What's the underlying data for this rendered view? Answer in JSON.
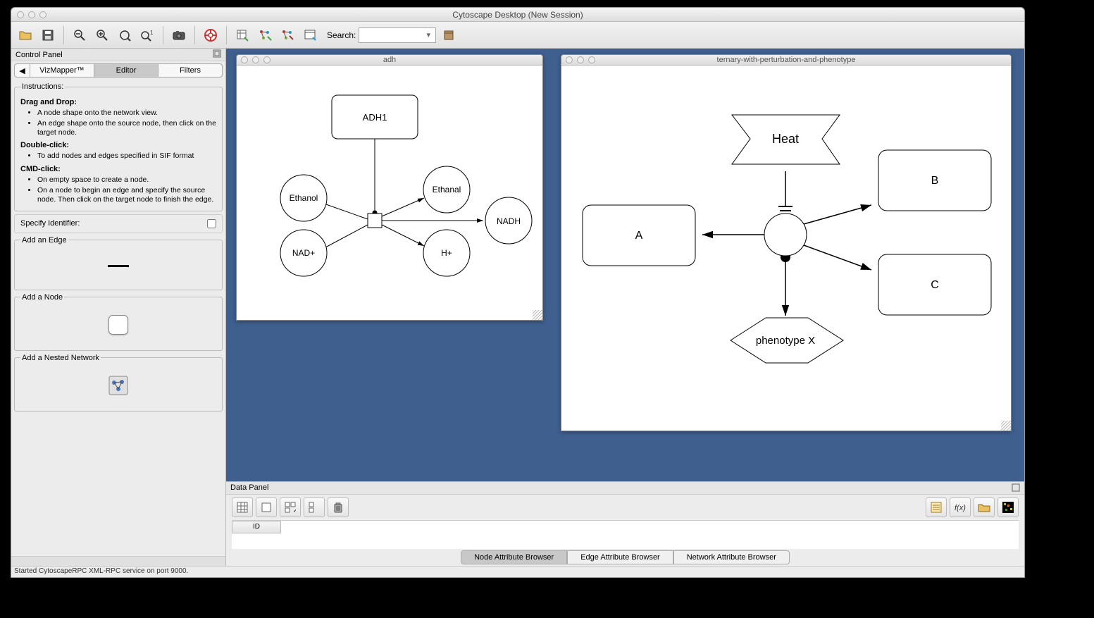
{
  "window": {
    "title": "Cytoscape Desktop (New Session)"
  },
  "toolbar": {
    "search_label": "Search:"
  },
  "control_panel": {
    "header": "Control Panel",
    "tabs": {
      "vizmapper": "VizMapper™",
      "editor": "Editor",
      "filters": "Filters"
    },
    "instructions": {
      "legend": "Instructions:",
      "drag_label": "Drag and Drop:",
      "drag_items": [
        "A node shape onto the network view.",
        "An edge shape onto the source node, then click on the target node."
      ],
      "dbl_label": "Double-click:",
      "dbl_items": [
        "To add nodes and edges specified in SIF format"
      ],
      "cmd_label": "CMD-click:",
      "cmd_items": [
        "On empty space to create a node.",
        "On a node to begin an edge and specify the source node. Then click on the target node to finish the edge."
      ]
    },
    "specify_identifier": "Specify Identifier:",
    "add_edge": "Add an Edge",
    "add_node": "Add a Node",
    "add_nested": "Add a Nested Network"
  },
  "networks": {
    "adh": {
      "title": "adh",
      "nodes": {
        "adh1": "ADH1",
        "ethanol": "Ethanol",
        "nad": "NAD+",
        "ethanal": "Ethanal",
        "h": "H+",
        "nadh": "NADH"
      }
    },
    "ternary": {
      "title": "ternary-with-perturbation-and-phenotype",
      "nodes": {
        "heat": "Heat",
        "a": "A",
        "b": "B",
        "c": "C",
        "phenotype": "phenotype X"
      }
    }
  },
  "data_panel": {
    "header": "Data Panel",
    "col_id": "ID",
    "tabs": {
      "node": "Node Attribute Browser",
      "edge": "Edge Attribute Browser",
      "network": "Network Attribute Browser"
    }
  },
  "status": "Started CytoscapeRPC XML-RPC service on port 9000."
}
